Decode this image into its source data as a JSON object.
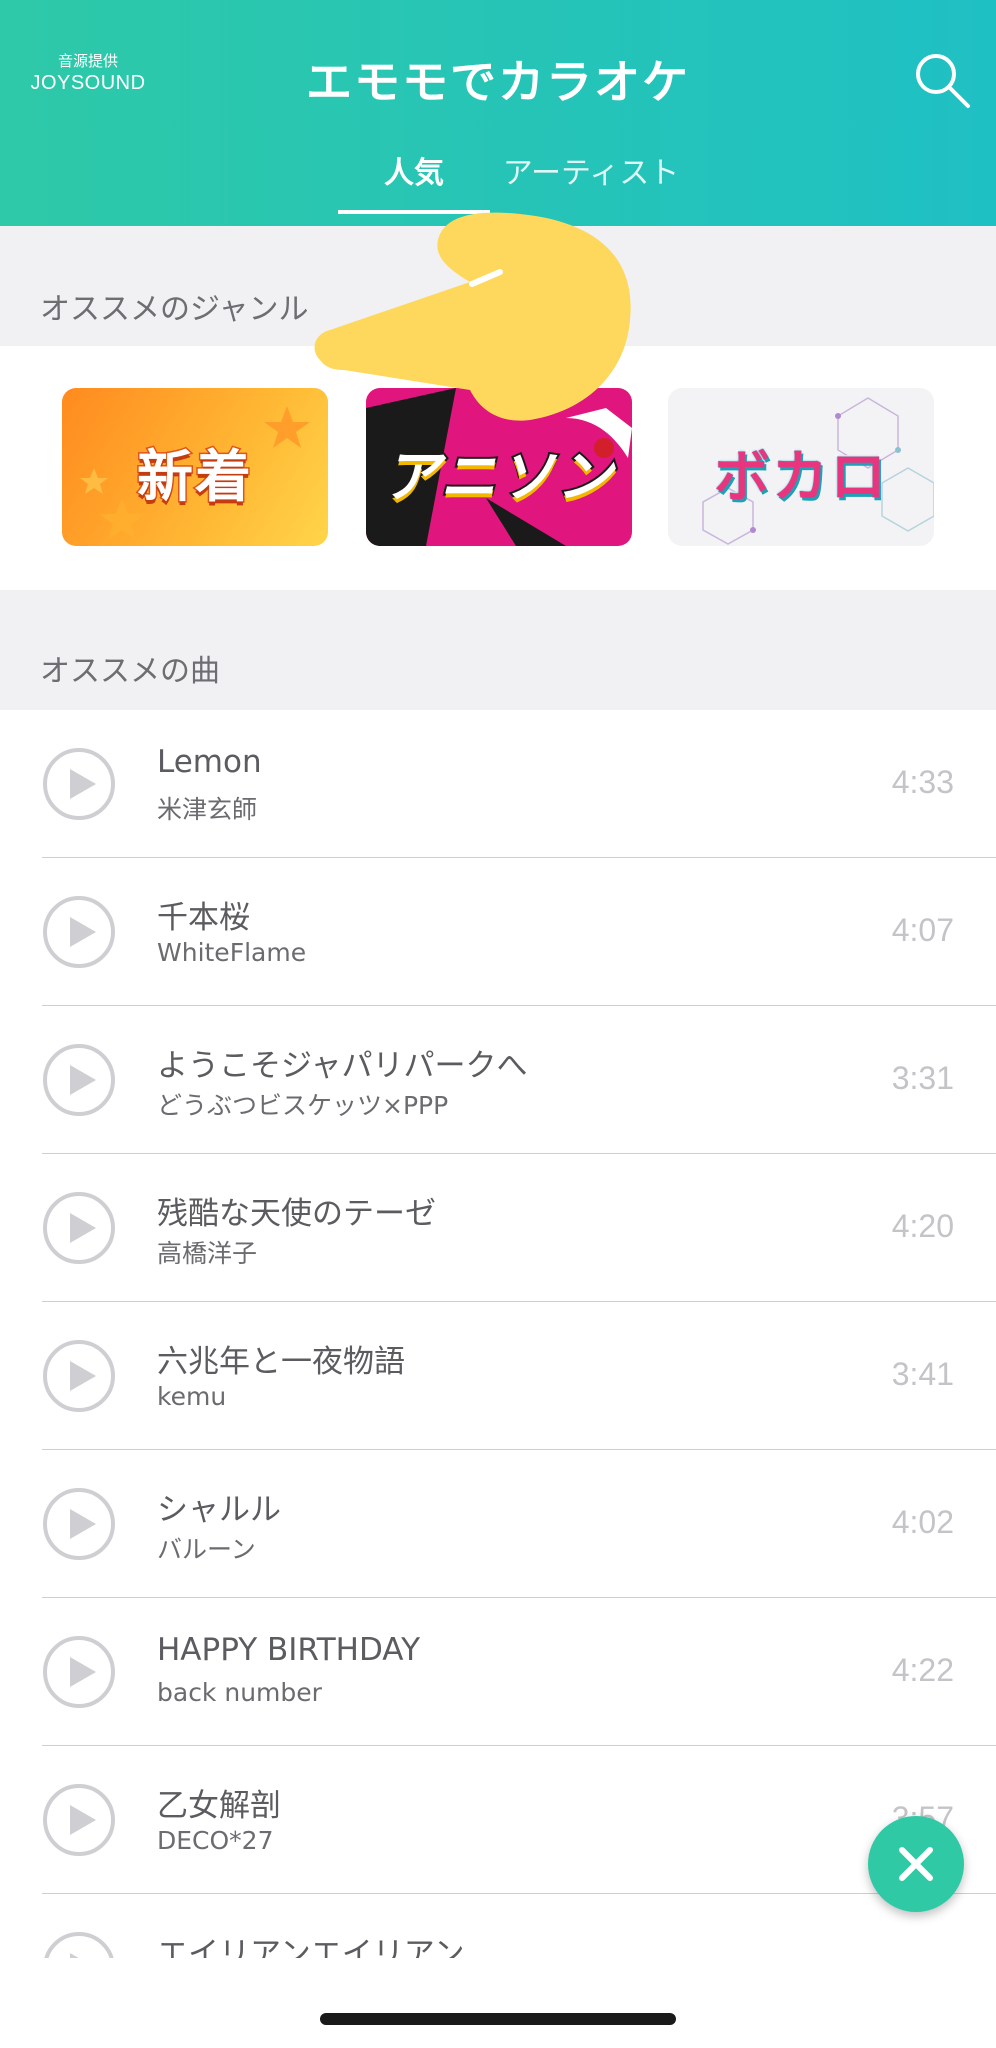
{
  "header": {
    "provider_label": "音源提供",
    "provider_brand": "JOYSOUND",
    "title": "エモモでカラオケ",
    "search_icon": "search-icon"
  },
  "tabs": [
    {
      "label": "人気",
      "active": true
    },
    {
      "label": "アーティスト",
      "active": false
    }
  ],
  "genres": {
    "section_title": "オススメのジャンル",
    "items": [
      {
        "label": "新着"
      },
      {
        "label": "アニソン"
      },
      {
        "label": "ボカロ"
      }
    ]
  },
  "songs": {
    "section_title": "オススメの曲",
    "items": [
      {
        "title": "Lemon",
        "artist": "米津玄師",
        "duration": "4:33"
      },
      {
        "title": "千本桜",
        "artist": "WhiteFlame",
        "duration": "4:07"
      },
      {
        "title": "ようこそジャパリパークへ",
        "artist": "どうぶつビスケッツ×PPP",
        "duration": "3:31"
      },
      {
        "title": "残酷な天使のテーゼ",
        "artist": "高橋洋子",
        "duration": "4:20"
      },
      {
        "title": "六兆年と一夜物語",
        "artist": "kemu",
        "duration": "3:41"
      },
      {
        "title": "シャルル",
        "artist": "バルーン",
        "duration": "4:02"
      },
      {
        "title": "HAPPY BIRTHDAY",
        "artist": "back number",
        "duration": "4:22"
      },
      {
        "title": "乙女解剖",
        "artist": "DECO*27",
        "duration": "3:57"
      },
      {
        "title": "エイリアンエイリアン",
        "artist": "",
        "duration": ""
      }
    ]
  },
  "colors": {
    "header_start": "#2ec9a8",
    "header_end": "#1fc0c4",
    "fab": "#2fcaa5"
  },
  "fab": {
    "icon": "close-icon"
  }
}
